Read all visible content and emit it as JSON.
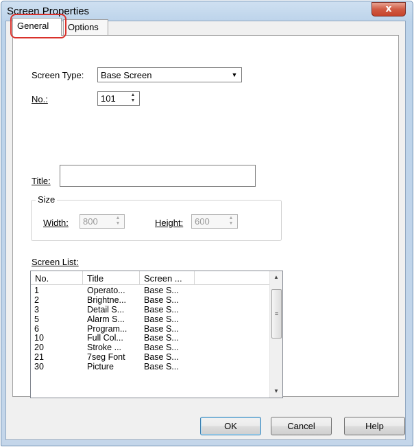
{
  "window": {
    "title": "Screen Properties",
    "close_glyph": "x"
  },
  "tabs": [
    {
      "label": "General"
    },
    {
      "label": "Options"
    }
  ],
  "general": {
    "screen_type_label": "Screen Type:",
    "screen_type_value": "Base Screen",
    "no_label": "No.:",
    "no_value": "101",
    "title_label": "Title:",
    "title_value": "",
    "size_group_label": "Size",
    "width_label": "Width:",
    "width_value": "800",
    "height_label": "Height:",
    "height_value": "600",
    "screen_list_label": "Screen List:"
  },
  "screen_list": {
    "columns": [
      "No.",
      "Title",
      "Screen ..."
    ],
    "rows": [
      {
        "no": "1",
        "title": "Operato...",
        "screen": "Base S..."
      },
      {
        "no": "2",
        "title": "Brightne...",
        "screen": "Base S..."
      },
      {
        "no": "3",
        "title": "Detail S...",
        "screen": "Base S..."
      },
      {
        "no": "5",
        "title": "Alarm S...",
        "screen": "Base S..."
      },
      {
        "no": "6",
        "title": "Program...",
        "screen": "Base S..."
      },
      {
        "no": "10",
        "title": "Full Col...",
        "screen": "Base S..."
      },
      {
        "no": "20",
        "title": "Stroke ...",
        "screen": "Base S..."
      },
      {
        "no": "21",
        "title": "7seg Font",
        "screen": "Base S..."
      },
      {
        "no": "30",
        "title": "Picture",
        "screen": "Base S..."
      }
    ]
  },
  "buttons": {
    "ok": "OK",
    "cancel": "Cancel",
    "help": "Help"
  },
  "icons": {
    "dropdown": "chevron-down-icon",
    "spin": "spin-arrows-icon",
    "scroll_up": "scroll-up-icon",
    "scroll_down": "scroll-down-icon",
    "close": "close-icon"
  },
  "colors": {
    "highlight": "#d9312b",
    "close_button": "#c7432b"
  }
}
